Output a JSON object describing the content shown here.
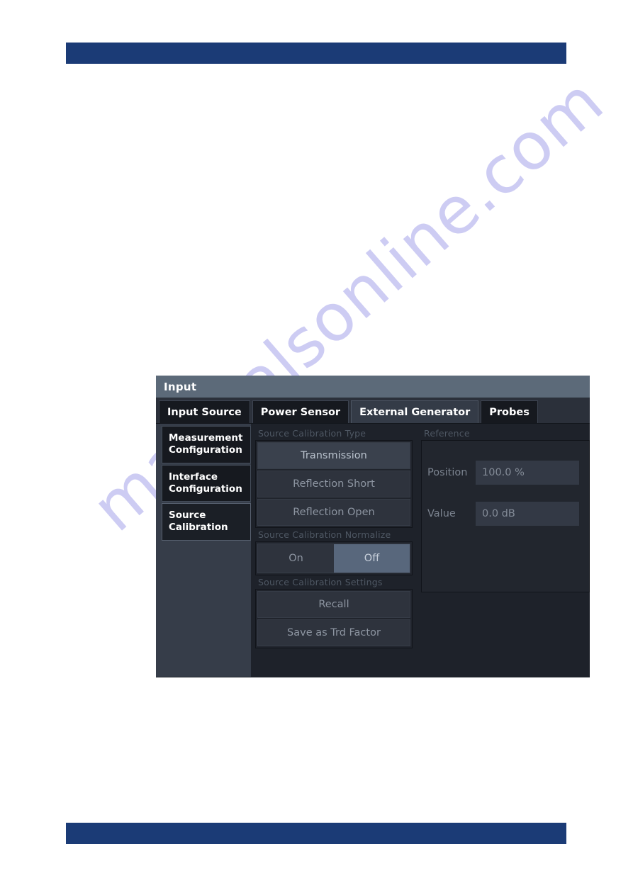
{
  "page": {
    "background_color": "#ffffff",
    "bar_color": "#1b3b76",
    "watermark_text": "manualsonline.com",
    "watermark_color": "#5856d6"
  },
  "dialog": {
    "title": "Input",
    "titlebar_color": "#5c6a79",
    "background_color": "#1e222a",
    "tabs": [
      {
        "label": "Input Source",
        "active": false
      },
      {
        "label": "Power Sensor",
        "active": false
      },
      {
        "label": "External Generator",
        "active": true
      },
      {
        "label": "Probes",
        "active": false
      }
    ],
    "sidebar": {
      "items": [
        {
          "label": "Measurement Configuration",
          "selected": false
        },
        {
          "label": "Interface Configuration",
          "selected": false
        },
        {
          "label": "Source Calibration",
          "selected": true
        }
      ]
    },
    "groups": {
      "calibration_type": {
        "label": "Source Calibration Type",
        "buttons": [
          {
            "label": "Transmission",
            "selected": true
          },
          {
            "label": "Reflection Short",
            "selected": false
          },
          {
            "label": "Reflection Open",
            "selected": false
          }
        ]
      },
      "normalize": {
        "label": "Source Calibration Normalize",
        "on_label": "On",
        "off_label": "Off",
        "selected": "Off"
      },
      "settings": {
        "label": "Source Calibration Settings",
        "buttons": [
          {
            "label": "Recall",
            "selected": false
          },
          {
            "label": "Save as Trd Factor",
            "selected": false
          }
        ]
      },
      "reference": {
        "label": "Reference",
        "fields": [
          {
            "label": "Position",
            "value": "100.0 %"
          },
          {
            "label": "Value",
            "value": "0.0 dB"
          }
        ]
      }
    }
  }
}
